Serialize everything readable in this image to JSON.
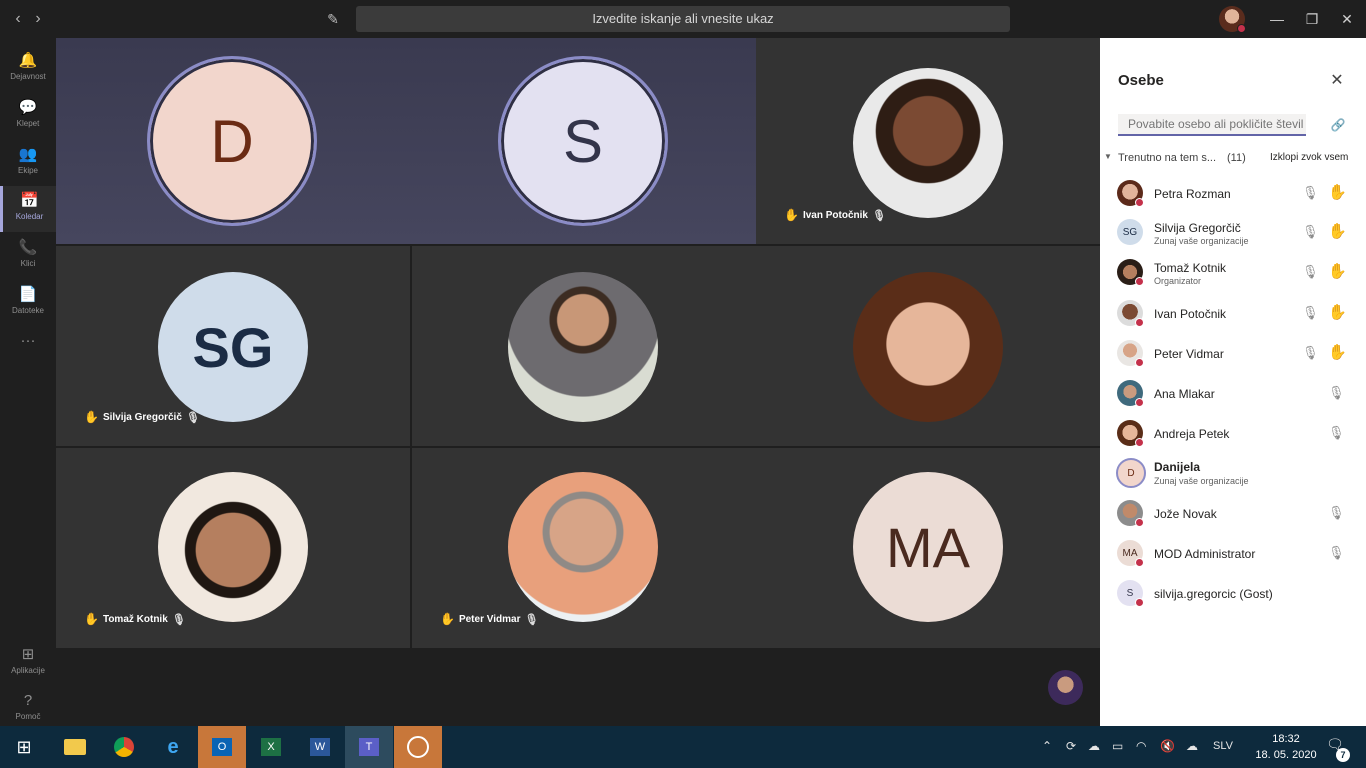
{
  "titlebar": {
    "search_placeholder": "Izvedite iskanje ali vnesite ukaz",
    "back": "‹",
    "forward": "›",
    "minimize": "—",
    "restore": "❐",
    "close": "✕"
  },
  "rail": {
    "items": [
      {
        "label": "Dejavnost",
        "icon": "bell-icon",
        "glyph": "🔔"
      },
      {
        "label": "Klepet",
        "icon": "chat-icon",
        "glyph": "💬"
      },
      {
        "label": "Ekipe",
        "icon": "teams-icon",
        "glyph": "👥"
      },
      {
        "label": "Koledar",
        "icon": "calendar-icon",
        "glyph": "📅"
      },
      {
        "label": "Klici",
        "icon": "phone-icon",
        "glyph": "📞"
      },
      {
        "label": "Datoteke",
        "icon": "file-icon",
        "glyph": "📄"
      },
      {
        "label": "",
        "icon": "more-icon",
        "glyph": "···"
      },
      {
        "label": "Aplikacije",
        "icon": "apps-icon",
        "glyph": "⊞"
      },
      {
        "label": "Pomoč",
        "icon": "help-icon",
        "glyph": "?"
      }
    ]
  },
  "stage": {
    "tiles": [
      {
        "initials": "D",
        "name": ""
      },
      {
        "initials": "S",
        "name": ""
      },
      {
        "initials": "",
        "name": "Ivan Potočnik"
      },
      {
        "initials": "SG",
        "name": "Silvija Gregorčič"
      },
      {
        "initials": "",
        "name": ""
      },
      {
        "initials": "",
        "name": ""
      },
      {
        "initials": "",
        "name": "Tomaž Kotnik"
      },
      {
        "initials": "",
        "name": "Peter Vidmar"
      },
      {
        "initials": "MA",
        "name": ""
      }
    ]
  },
  "panel": {
    "title": "Osebe",
    "invite_placeholder": "Povabite osebo ali pokličite števil",
    "section_label": "Trenutno na tem s...",
    "section_count": "(11)",
    "mute_all": "Izklopi zvok vsem",
    "people": [
      {
        "name": "Petra Rozman",
        "sub": "",
        "initials": "",
        "mic": true,
        "hand": true
      },
      {
        "name": "Silvija Gregorčič",
        "sub": "Zunaj vaše organizacije",
        "initials": "SG",
        "mic": true,
        "hand": true
      },
      {
        "name": "Tomaž Kotnik",
        "sub": "Organizator",
        "initials": "",
        "mic": true,
        "hand": true
      },
      {
        "name": "Ivan Potočnik",
        "sub": "",
        "initials": "",
        "mic": true,
        "hand": true
      },
      {
        "name": "Peter Vidmar",
        "sub": "",
        "initials": "",
        "mic": true,
        "hand": true
      },
      {
        "name": "Ana Mlakar",
        "sub": "",
        "initials": "",
        "mic": true,
        "hand": false
      },
      {
        "name": "Andreja Petek",
        "sub": "",
        "initials": "",
        "mic": true,
        "hand": false
      },
      {
        "name": "Danijela",
        "sub": "Zunaj vaše organizacije",
        "initials": "D",
        "mic": false,
        "hand": false
      },
      {
        "name": "Jože Novak",
        "sub": "",
        "initials": "",
        "mic": true,
        "hand": false
      },
      {
        "name": "MOD Administrator",
        "sub": "",
        "initials": "MA",
        "mic": true,
        "hand": false
      },
      {
        "name": "silvija.gregorcic (Gost)",
        "sub": "",
        "initials": "S",
        "mic": false,
        "hand": false
      }
    ]
  },
  "taskbar": {
    "language": "SLV",
    "time": "18:32",
    "date": "18. 05. 2020",
    "notifications": "7"
  },
  "colors": {
    "accent": "#6264a7",
    "presence_busy": "#c4314b",
    "hand": "#f3b52c"
  }
}
